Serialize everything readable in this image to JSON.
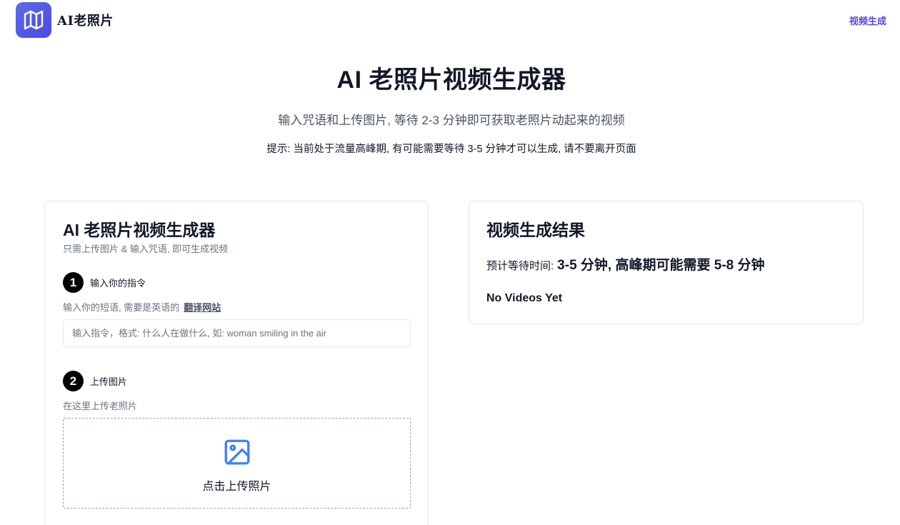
{
  "header": {
    "brand": "AI老照片",
    "nav_link": "视频生成",
    "logo_icon": "map-icon"
  },
  "hero": {
    "title": "AI 老照片视频生成器",
    "subtitle": "输入咒语和上传图片, 等待 2-3 分钟即可获取老照片动起来的视频",
    "tip": "提示: 当前处于流量高峰期, 有可能需要等待 3-5 分钟才可以生成, 请不要离开页面"
  },
  "form_card": {
    "title": "AI 老照片视频生成器",
    "subtitle": "只需上传图片 & 输入咒语, 即可生成视频",
    "step1": {
      "number": "1",
      "label": "输入你的指令",
      "hint": "输入你的短语, 需要是英语的",
      "link": "翻译网站",
      "placeholder": "输入指令，格式: 什么人在做什么, 如: woman smiling in the air",
      "value": ""
    },
    "step2": {
      "number": "2",
      "label": "上传图片",
      "hint": "在这里上传老照片",
      "upload_label": "点击上传照片",
      "upload_icon": "image-icon"
    }
  },
  "result_card": {
    "title": "视频生成结果",
    "wait_label": "预计等待时间:",
    "wait_value": "3-5 分钟, 高峰期可能需要 5-8 分钟",
    "empty_text": "No Videos Yet"
  },
  "colors": {
    "accent": "#4f46e5",
    "icon_blue": "#3b82f6"
  }
}
